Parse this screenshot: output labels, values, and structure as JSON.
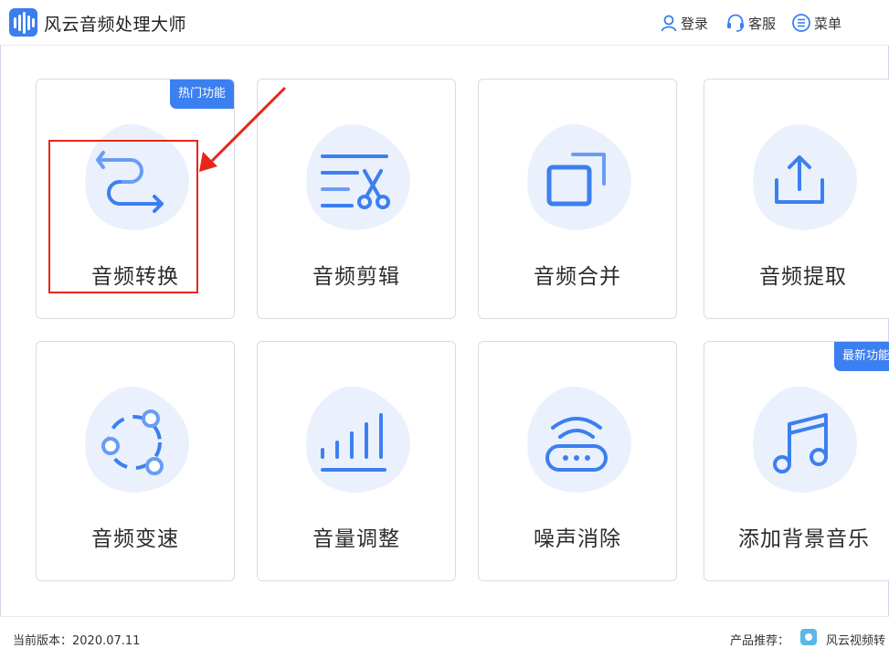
{
  "app": {
    "title": "风云音频处理大师"
  },
  "header": {
    "login_label": "登录",
    "service_label": "客服",
    "menu_label": "菜单",
    "icons": [
      "user-icon",
      "headset-icon",
      "menu-icon"
    ]
  },
  "cards": [
    {
      "label": "音频转换",
      "icon": "convert-arrows-icon",
      "badge": "热门功能"
    },
    {
      "label": "音频剪辑",
      "icon": "scissors-edit-icon",
      "badge": ""
    },
    {
      "label": "音频合并",
      "icon": "merge-windows-icon",
      "badge": ""
    },
    {
      "label": "音频提取",
      "icon": "extract-upload-icon",
      "badge": ""
    },
    {
      "label": "音频变速",
      "icon": "speed-circle-icon",
      "badge": ""
    },
    {
      "label": "音量调整",
      "icon": "volume-bars-icon",
      "badge": ""
    },
    {
      "label": "噪声消除",
      "icon": "noise-router-icon",
      "badge": ""
    },
    {
      "label": "添加背景音乐",
      "icon": "music-note-icon",
      "badge": "最新功能"
    }
  ],
  "footer": {
    "version": "当前版本：2020.07.11",
    "recommend_label": "产品推荐：",
    "recommend_product": "风云视频转"
  },
  "colors": {
    "accent": "#3c7ff0",
    "blob": "#eaf1fd",
    "highlight": "#e8251c"
  }
}
